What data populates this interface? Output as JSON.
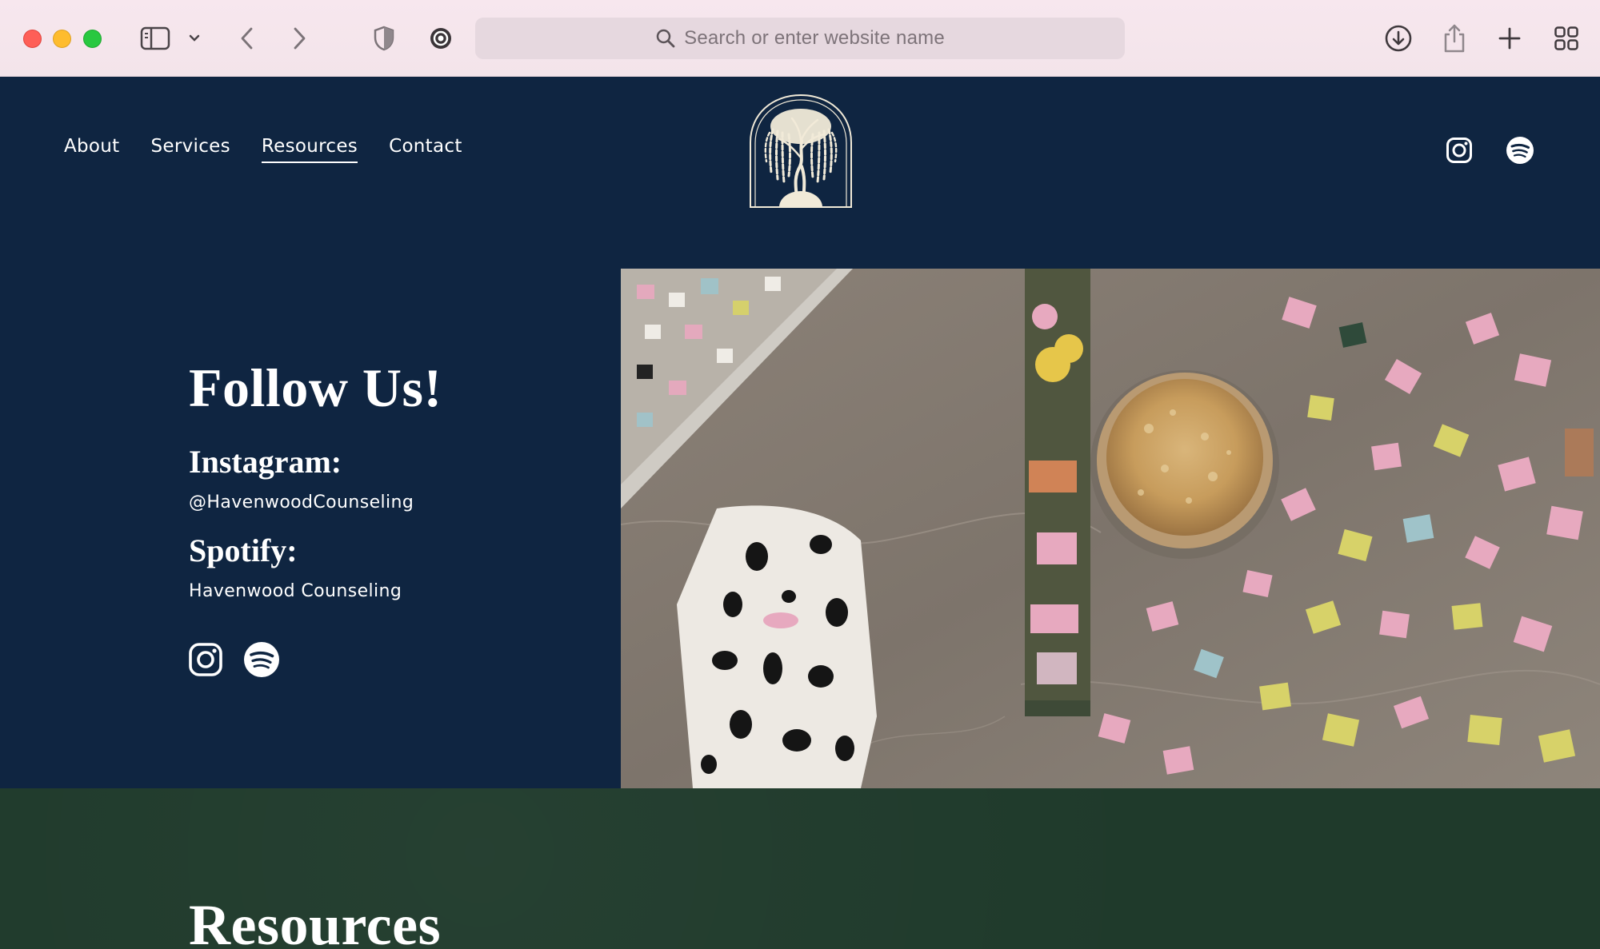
{
  "browser": {
    "address_placeholder": "Search or enter website name",
    "icons": [
      "sidebar-icon",
      "chevron-down-icon",
      "back-icon",
      "forward-icon",
      "shield-icon",
      "extension-icon",
      "search-icon",
      "download-icon",
      "share-icon",
      "plus-icon",
      "tab-overview-icon"
    ]
  },
  "header": {
    "nav": {
      "about": "About",
      "services": "Services",
      "resources": "Resources",
      "contact": "Contact"
    },
    "active_nav": "Resources",
    "logo_icon": "willow-tree-logo"
  },
  "follow": {
    "title": "Follow Us!",
    "instagram_label": "Instagram:",
    "instagram_handle": "@HavenwoodCounseling",
    "spotify_label": "Spotify:",
    "spotify_name": "Havenwood Counseling"
  },
  "resources": {
    "title": "Resources"
  },
  "colors": {
    "navy": "#0f2541",
    "forest": "#1f3a2b",
    "chrome": "#f5e6ec"
  }
}
